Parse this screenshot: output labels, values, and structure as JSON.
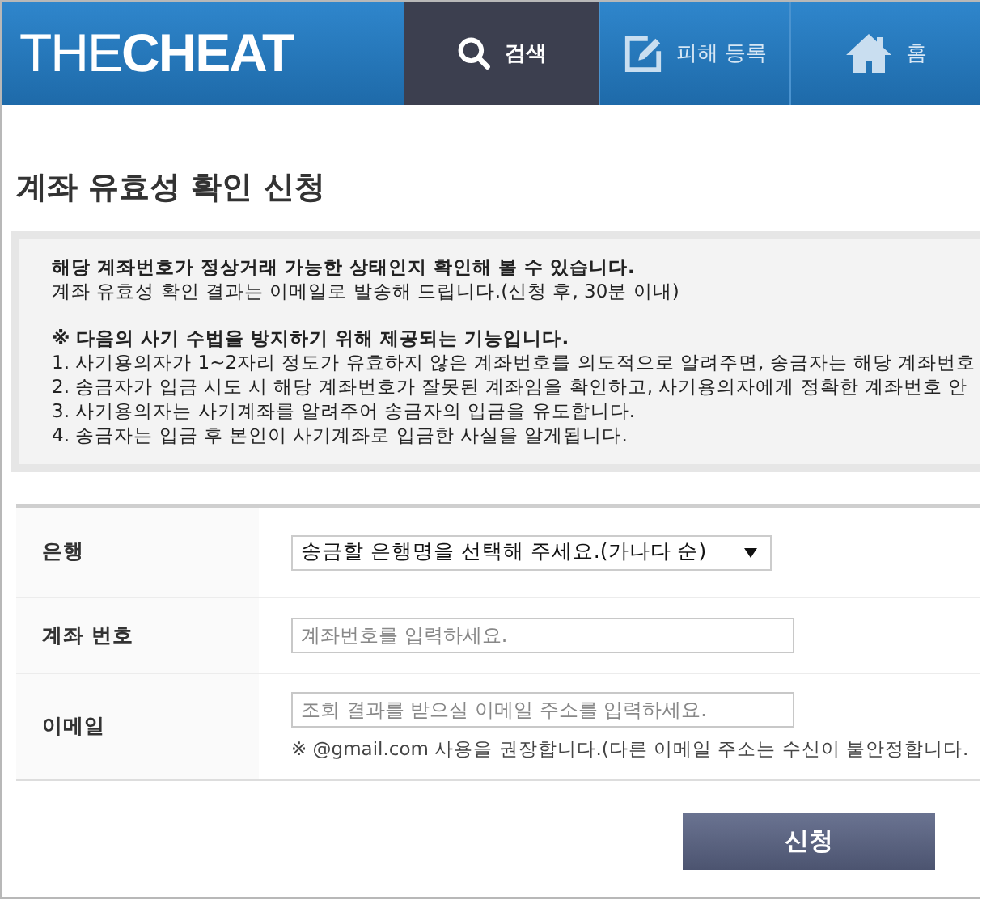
{
  "header": {
    "logo": "THE**CHEAT**",
    "nav": [
      {
        "label": "검색",
        "kind": "search",
        "selected": true
      },
      {
        "label": "피해 등록",
        "kind": "edit",
        "selected": false
      },
      {
        "label": "홈",
        "kind": "home",
        "selected": false
      }
    ]
  },
  "title": "계좌 유효성 확인 신청",
  "notice": {
    "heading": "해당 계좌번호가 정상거래 가능한 상태인지 확인해 볼 수 있습니다.",
    "line": "계좌 유효성 확인 결과는 이메일로 발송해 드립니다.(신청 후, 30분 이내)",
    "subheading": "※ 다음의 사기 수법을 방지하기 위해 제공되는 기능입니다.",
    "items": [
      "1. 사기용의자가 1~2자리 정도가 유효하지 않은 계좌번호를 의도적으로 알려주면, 송금자는 해당 계좌번호",
      "2. 송금자가 입금 시도 시 해당 계좌번호가 잘못된 계좌임을 확인하고, 사기용의자에게 정확한 계좌번호 안",
      "3. 사기용의자는 사기계좌를 알려주어 송금자의 입금을 유도합니다.",
      "4. 송금자는 입금 후 본인이 사기계좌로 입금한 사실을 알게됩니다."
    ]
  },
  "form": [
    {
      "label": "은행",
      "kind": "select",
      "value": "송금할 은행명을 선택해 주세요.(가나다 순)"
    },
    {
      "label": "계좌 번호",
      "kind": "input",
      "placeholder": "계좌번호를 입력하세요."
    },
    {
      "label": "이메일",
      "kind": "input",
      "placeholder": "조회 결과를 받으실 이메일 주소를 입력하세요.",
      "note": "※ @gmail.com 사용을 권장합니다.(다른 이메일 주소는 수신이 불안정합니다."
    }
  ],
  "submit": "신청"
}
